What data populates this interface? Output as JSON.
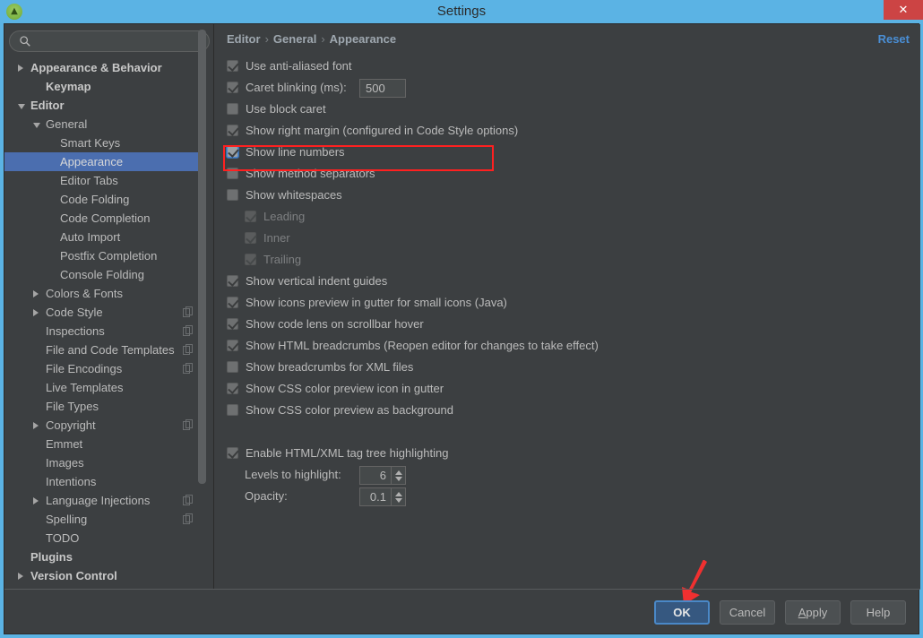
{
  "window": {
    "title": "Settings",
    "app_icon": "android-studio-icon",
    "close_label": "✕"
  },
  "search": {
    "value": "",
    "placeholder": "",
    "icon": "search-icon"
  },
  "sidebar": {
    "items": [
      {
        "label": "Appearance & Behavior",
        "indent": 0,
        "arrow": "right",
        "bold": true,
        "selected": false,
        "badge": false
      },
      {
        "label": "Keymap",
        "indent": 1,
        "arrow": "none",
        "bold": true,
        "selected": false,
        "badge": false
      },
      {
        "label": "Editor",
        "indent": 0,
        "arrow": "down",
        "bold": true,
        "selected": false,
        "badge": false
      },
      {
        "label": "General",
        "indent": 1,
        "arrow": "down",
        "bold": false,
        "selected": false,
        "badge": false
      },
      {
        "label": "Smart Keys",
        "indent": 2,
        "arrow": "none",
        "bold": false,
        "selected": false,
        "badge": false
      },
      {
        "label": "Appearance",
        "indent": 2,
        "arrow": "none",
        "bold": false,
        "selected": true,
        "badge": false
      },
      {
        "label": "Editor Tabs",
        "indent": 2,
        "arrow": "none",
        "bold": false,
        "selected": false,
        "badge": false
      },
      {
        "label": "Code Folding",
        "indent": 2,
        "arrow": "none",
        "bold": false,
        "selected": false,
        "badge": false
      },
      {
        "label": "Code Completion",
        "indent": 2,
        "arrow": "none",
        "bold": false,
        "selected": false,
        "badge": false
      },
      {
        "label": "Auto Import",
        "indent": 2,
        "arrow": "none",
        "bold": false,
        "selected": false,
        "badge": false
      },
      {
        "label": "Postfix Completion",
        "indent": 2,
        "arrow": "none",
        "bold": false,
        "selected": false,
        "badge": false
      },
      {
        "label": "Console Folding",
        "indent": 2,
        "arrow": "none",
        "bold": false,
        "selected": false,
        "badge": false
      },
      {
        "label": "Colors & Fonts",
        "indent": 1,
        "arrow": "right",
        "bold": false,
        "selected": false,
        "badge": false
      },
      {
        "label": "Code Style",
        "indent": 1,
        "arrow": "right",
        "bold": false,
        "selected": false,
        "badge": true
      },
      {
        "label": "Inspections",
        "indent": 1,
        "arrow": "none",
        "bold": false,
        "selected": false,
        "badge": true
      },
      {
        "label": "File and Code Templates",
        "indent": 1,
        "arrow": "none",
        "bold": false,
        "selected": false,
        "badge": true
      },
      {
        "label": "File Encodings",
        "indent": 1,
        "arrow": "none",
        "bold": false,
        "selected": false,
        "badge": true
      },
      {
        "label": "Live Templates",
        "indent": 1,
        "arrow": "none",
        "bold": false,
        "selected": false,
        "badge": false
      },
      {
        "label": "File Types",
        "indent": 1,
        "arrow": "none",
        "bold": false,
        "selected": false,
        "badge": false
      },
      {
        "label": "Copyright",
        "indent": 1,
        "arrow": "right",
        "bold": false,
        "selected": false,
        "badge": true
      },
      {
        "label": "Emmet",
        "indent": 1,
        "arrow": "none",
        "bold": false,
        "selected": false,
        "badge": false
      },
      {
        "label": "Images",
        "indent": 1,
        "arrow": "none",
        "bold": false,
        "selected": false,
        "badge": false
      },
      {
        "label": "Intentions",
        "indent": 1,
        "arrow": "none",
        "bold": false,
        "selected": false,
        "badge": false
      },
      {
        "label": "Language Injections",
        "indent": 1,
        "arrow": "right",
        "bold": false,
        "selected": false,
        "badge": true
      },
      {
        "label": "Spelling",
        "indent": 1,
        "arrow": "none",
        "bold": false,
        "selected": false,
        "badge": true
      },
      {
        "label": "TODO",
        "indent": 1,
        "arrow": "none",
        "bold": false,
        "selected": false,
        "badge": false
      },
      {
        "label": "Plugins",
        "indent": 0,
        "arrow": "none",
        "bold": true,
        "selected": false,
        "badge": false
      },
      {
        "label": "Version Control",
        "indent": 0,
        "arrow": "right",
        "bold": true,
        "selected": false,
        "badge": false
      }
    ]
  },
  "breadcrumb": {
    "parts": [
      "Editor",
      "General",
      "Appearance"
    ],
    "separator": "›"
  },
  "reset": {
    "label": "Reset"
  },
  "options": [
    {
      "label": "Use anti-aliased font",
      "checked": true,
      "disabled": false,
      "indented": false,
      "focused": false
    },
    {
      "label": "Caret blinking (ms):",
      "checked": true,
      "disabled": false,
      "indented": false,
      "focused": false,
      "field": "500"
    },
    {
      "label": "Use block caret",
      "checked": false,
      "disabled": false,
      "indented": false,
      "focused": false
    },
    {
      "label": "Show right margin (configured in Code Style options)",
      "checked": true,
      "disabled": false,
      "indented": false,
      "focused": false
    },
    {
      "label": "Show line numbers",
      "checked": true,
      "disabled": false,
      "indented": false,
      "focused": true
    },
    {
      "label": "Show method separators",
      "checked": false,
      "disabled": false,
      "indented": false,
      "focused": false
    },
    {
      "label": "Show whitespaces",
      "checked": false,
      "disabled": false,
      "indented": false,
      "focused": false
    },
    {
      "label": "Leading",
      "checked": true,
      "disabled": true,
      "indented": true,
      "focused": false
    },
    {
      "label": "Inner",
      "checked": true,
      "disabled": true,
      "indented": true,
      "focused": false
    },
    {
      "label": "Trailing",
      "checked": true,
      "disabled": true,
      "indented": true,
      "focused": false
    },
    {
      "label": "Show vertical indent guides",
      "checked": true,
      "disabled": false,
      "indented": false,
      "focused": false
    },
    {
      "label": "Show icons preview in gutter for small icons (Java)",
      "checked": true,
      "disabled": false,
      "indented": false,
      "focused": false
    },
    {
      "label": "Show code lens on scrollbar hover",
      "checked": true,
      "disabled": false,
      "indented": false,
      "focused": false
    },
    {
      "label": "Show HTML breadcrumbs (Reopen editor for changes to take effect)",
      "checked": true,
      "disabled": false,
      "indented": false,
      "focused": false
    },
    {
      "label": "Show breadcrumbs for XML files",
      "checked": false,
      "disabled": false,
      "indented": false,
      "focused": false
    },
    {
      "label": "Show CSS color preview icon in gutter",
      "checked": true,
      "disabled": false,
      "indented": false,
      "focused": false
    },
    {
      "label": "Show CSS color preview as background",
      "checked": false,
      "disabled": false,
      "indented": false,
      "focused": false
    },
    {
      "label": "Enable HTML/XML tag tree highlighting",
      "checked": true,
      "disabled": false,
      "indented": false,
      "focused": false,
      "gap_before": true
    }
  ],
  "spinners": [
    {
      "label": "Levels to highlight:",
      "value": "6"
    },
    {
      "label": "Opacity:",
      "value": "0.1"
    }
  ],
  "buttons": [
    {
      "label": "OK",
      "primary": true,
      "mnemonic": ""
    },
    {
      "label": "Cancel",
      "primary": false,
      "mnemonic": ""
    },
    {
      "label": "Apply",
      "primary": false,
      "mnemonic": "A"
    },
    {
      "label": "Help",
      "primary": false,
      "mnemonic": ""
    }
  ],
  "annotations": {
    "highlight_color": "#ff2020",
    "arrow_color": "#f03030",
    "highlight_target": "Show line numbers",
    "arrow_target": "OK"
  },
  "colors": {
    "window_frame": "#5bb3e4",
    "dialog_bg": "#3c3f41",
    "selection": "#4b6eaf",
    "accent_link": "#4a8fd6",
    "primary_button": "#365880"
  }
}
